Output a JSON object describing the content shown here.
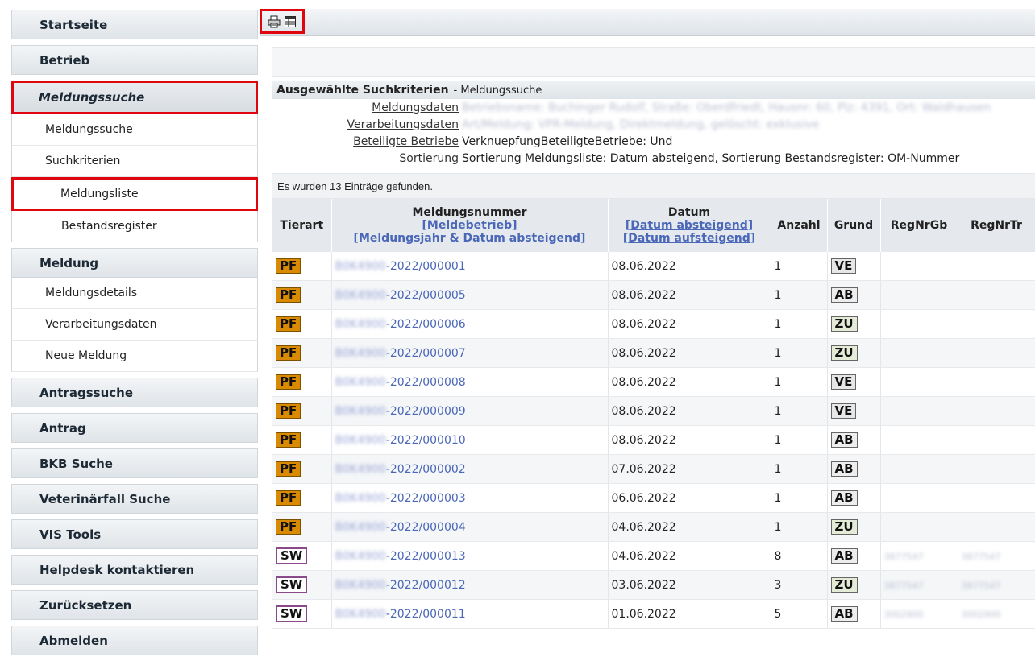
{
  "sidebar": {
    "startseite": "Startseite",
    "betrieb": "Betrieb",
    "meldungssuche_header": "Meldungssuche",
    "meldungssuche_sub": "Meldungssuche",
    "suchkriterien": "Suchkriterien",
    "meldungsliste": "Meldungsliste",
    "bestandsregister": "Bestandsregister",
    "meldung_header": "Meldung",
    "meldungsdetails": "Meldungsdetails",
    "verarbeitungsdaten": "Verarbeitungsdaten",
    "neue_meldung": "Neue Meldung",
    "antragssuche": "Antragssuche",
    "antrag": "Antrag",
    "bkb_suche": "BKB Suche",
    "veterinaerfall": "Veterinärfall Suche",
    "vis_tools": "VIS Tools",
    "helpdesk": "Helpdesk kontaktieren",
    "zuruecksetzen": "Zurücksetzen",
    "abmelden": "Abmelden"
  },
  "toolbar": {
    "print_icon": "printer-icon",
    "table_icon": "table-icon"
  },
  "criteria": {
    "title": "Ausgewählte Suchkriterien",
    "subtitle": "- Meldungssuche",
    "rows": [
      {
        "key": "Meldungsdaten",
        "value": "Betriebsname: Buchinger Rudolf, Straße: Oberdfriedt, Hausnr: 60, Plz: 4391, Ort: Waldhausen",
        "blurred": true
      },
      {
        "key": "Verarbeitungsdaten",
        "value": "Art/Meldung: VPR-Meldung, Direktmeldung, gelöscht: exklusive",
        "blurred": true
      },
      {
        "key": "Beteiligte Betriebe",
        "value": "VerknuepfungBeteiligteBetriebe: Und",
        "blurred": false
      },
      {
        "key": "Sortierung",
        "value": "Sortierung Meldungsliste: Datum absteigend, Sortierung Bestandsregister: OM-Nummer",
        "blurred": false
      }
    ]
  },
  "found_text": "Es wurden 13 Einträge gefunden.",
  "table": {
    "headers": {
      "tierart": "Tierart",
      "meldungsnummer": "Meldungsnummer",
      "meldebetrieb": "[Meldebetrieb]",
      "meldungsjahr": "[Meldungsjahr & Datum absteigend]",
      "datum": "Datum",
      "datum_ab": "Datum absteigend",
      "datum_auf": "Datum aufsteigend",
      "anzahl": "Anzahl",
      "grund": "Grund",
      "regnrgb": "RegNrGb",
      "regnrtr": "RegNrTr"
    },
    "rows": [
      {
        "tierart": "PF",
        "prefix": "B0K4900",
        "nr": "-2022/000001",
        "datum": "08.06.2022",
        "anzahl": "1",
        "grund": "VE",
        "gb": "",
        "tr": ""
      },
      {
        "tierart": "PF",
        "prefix": "B0K4900",
        "nr": "-2022/000005",
        "datum": "08.06.2022",
        "anzahl": "1",
        "grund": "AB",
        "gb": "",
        "tr": ""
      },
      {
        "tierart": "PF",
        "prefix": "B0K4900",
        "nr": "-2022/000006",
        "datum": "08.06.2022",
        "anzahl": "1",
        "grund": "ZU",
        "gb": "",
        "tr": ""
      },
      {
        "tierart": "PF",
        "prefix": "B0K4900",
        "nr": "-2022/000007",
        "datum": "08.06.2022",
        "anzahl": "1",
        "grund": "ZU",
        "gb": "",
        "tr": ""
      },
      {
        "tierart": "PF",
        "prefix": "B0K4900",
        "nr": "-2022/000008",
        "datum": "08.06.2022",
        "anzahl": "1",
        "grund": "VE",
        "gb": "",
        "tr": ""
      },
      {
        "tierart": "PF",
        "prefix": "B0K4900",
        "nr": "-2022/000009",
        "datum": "08.06.2022",
        "anzahl": "1",
        "grund": "VE",
        "gb": "",
        "tr": ""
      },
      {
        "tierart": "PF",
        "prefix": "B0K4900",
        "nr": "-2022/000010",
        "datum": "08.06.2022",
        "anzahl": "1",
        "grund": "AB",
        "gb": "",
        "tr": ""
      },
      {
        "tierart": "PF",
        "prefix": "B0K4900",
        "nr": "-2022/000002",
        "datum": "07.06.2022",
        "anzahl": "1",
        "grund": "AB",
        "gb": "",
        "tr": ""
      },
      {
        "tierart": "PF",
        "prefix": "B0K4900",
        "nr": "-2022/000003",
        "datum": "06.06.2022",
        "anzahl": "1",
        "grund": "AB",
        "gb": "",
        "tr": ""
      },
      {
        "tierart": "PF",
        "prefix": "B0K4900",
        "nr": "-2022/000004",
        "datum": "04.06.2022",
        "anzahl": "1",
        "grund": "ZU",
        "gb": "",
        "tr": ""
      },
      {
        "tierart": "SW",
        "prefix": "B0K4900",
        "nr": "-2022/000013",
        "datum": "04.06.2022",
        "anzahl": "8",
        "grund": "AB",
        "gb": "3877547",
        "tr": "3877547"
      },
      {
        "tierart": "SW",
        "prefix": "B0K4900",
        "nr": "-2022/000012",
        "datum": "03.06.2022",
        "anzahl": "3",
        "grund": "ZU",
        "gb": "3877547",
        "tr": "3877547"
      },
      {
        "tierart": "SW",
        "prefix": "B0K4900",
        "nr": "-2022/000011",
        "datum": "01.06.2022",
        "anzahl": "5",
        "grund": "AB",
        "gb": "3002900",
        "tr": "3002900"
      }
    ]
  },
  "colors": {
    "highlight": "#e0060f",
    "link": "#4a67b8",
    "pf_tag": "#d98a00"
  }
}
